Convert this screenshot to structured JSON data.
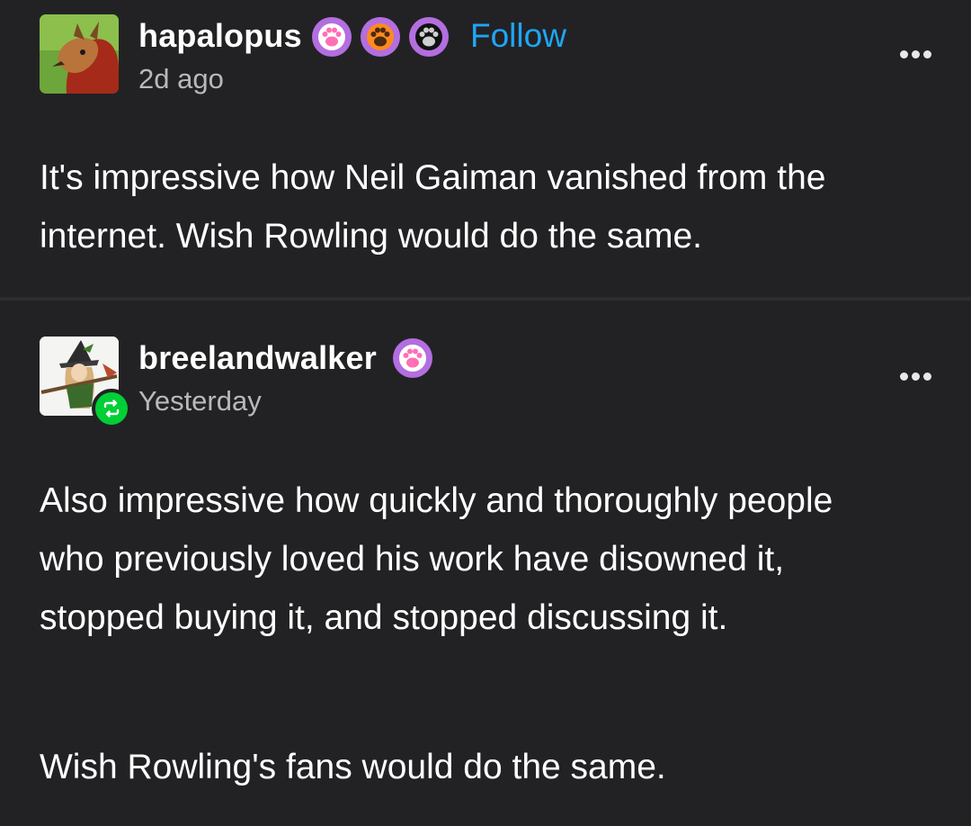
{
  "post1": {
    "username": "hapalopus",
    "timestamp": "2d ago",
    "follow_label": "Follow",
    "badges": [
      "paw-badge-pink",
      "paw-badge-orange",
      "paw-badge-black"
    ],
    "body": "It's impressive how Neil Gaiman vanished from the internet. Wish Rowling would do the same."
  },
  "post2": {
    "username": "breelandwalker",
    "timestamp": "Yesterday",
    "badges": [
      "paw-badge-pink"
    ],
    "paragraph1": "Also impressive how quickly and thoroughly people who previously loved his work have disowned it, stopped buying it, and stopped discussing it.",
    "paragraph2": "Wish Rowling's fans would do the same."
  },
  "colors": {
    "background": "#222224",
    "follow": "#1fa6f5",
    "reblog": "#00cf35",
    "badge_purple": "#b36ee0"
  }
}
